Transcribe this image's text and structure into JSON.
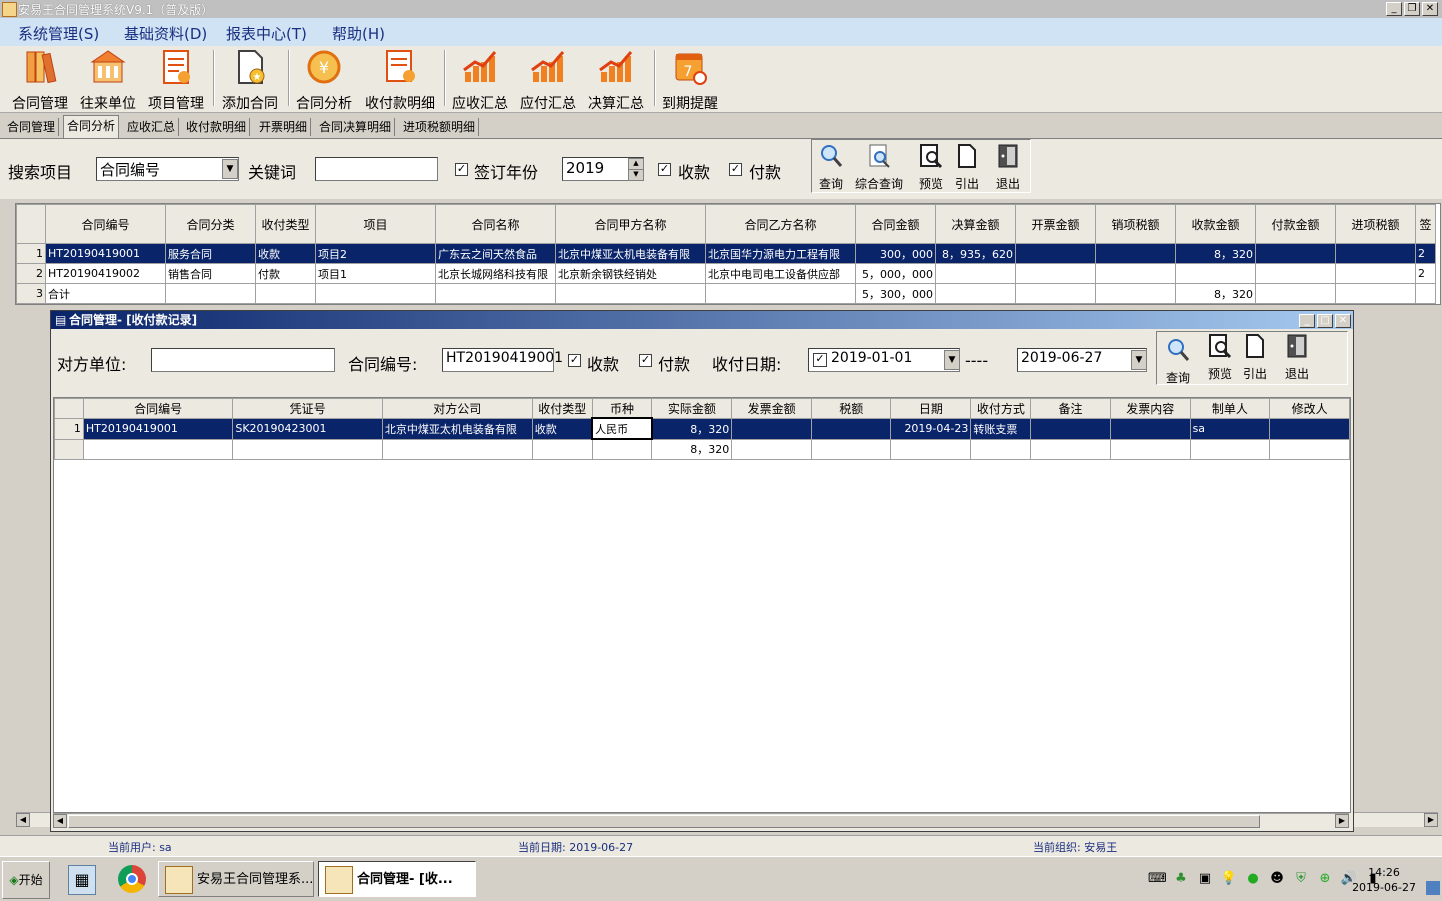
{
  "window": {
    "title": "安易王合同管理系统V9.1（普及版）"
  },
  "menu": [
    "系统管理(S)",
    "基础资料(D)",
    "报表中心(T)",
    "帮助(H)"
  ],
  "toolbar": [
    {
      "label": "合同管理",
      "icon": "contract-books-icon"
    },
    {
      "label": "往来单位",
      "icon": "building-icon"
    },
    {
      "label": "项目管理",
      "icon": "project-clipboard-icon"
    },
    {
      "label": "添加合同",
      "icon": "add-document-icon"
    },
    {
      "label": "合同分析",
      "icon": "coin-analysis-icon"
    },
    {
      "label": "收付款明细",
      "icon": "payment-detail-icon"
    },
    {
      "label": "应收汇总",
      "icon": "chart-up-icon"
    },
    {
      "label": "应付汇总",
      "icon": "chart-up-icon"
    },
    {
      "label": "决算汇总",
      "icon": "chart-up-icon"
    },
    {
      "label": "到期提醒",
      "icon": "calendar-alarm-icon"
    }
  ],
  "tabs": [
    "合同管理",
    "合同分析",
    "应收汇总",
    "收付款明细",
    "开票明细",
    "合同决算明细",
    "进项税额明细"
  ],
  "search": {
    "label_item": "搜索项目",
    "item_value": "合同编号",
    "label_keyword": "关键词",
    "keyword_value": "",
    "label_year": "签订年份",
    "year_value": "2019",
    "label_receive": "收款",
    "label_pay": "付款",
    "buttons": [
      "查询",
      "综合查询",
      "预览",
      "引出",
      "退出"
    ]
  },
  "grid1": {
    "headers": [
      "合同编号",
      "合同分类",
      "收付类型",
      "项目",
      "合同名称",
      "合同甲方名称",
      "合同乙方名称",
      "合同金额",
      "决算金额",
      "开票金额",
      "销项税额",
      "收款金额",
      "付款金额",
      "进项税额",
      "签"
    ],
    "rows": [
      [
        "1",
        "HT20190419001",
        "服务合同",
        "收款",
        "项目2",
        "广东云之间天然食品",
        "北京中煤亚太机电装备有限",
        "北京国华力源电力工程有限",
        "300，000",
        "8，935，620",
        "",
        "",
        "8，320",
        "",
        "",
        "2"
      ],
      [
        "2",
        "HT20190419002",
        "销售合同",
        "付款",
        "项目1",
        "北京长城网络科技有限",
        "北京新余钢铁经销处",
        "北京中电司电工设备供应部",
        "5，000，000",
        "",
        "",
        "",
        "",
        "",
        "",
        "2"
      ],
      [
        "3",
        "合计",
        "",
        "",
        "",
        "",
        "",
        "",
        "5，300，000",
        "",
        "",
        "",
        "8，320",
        "",
        "",
        ""
      ]
    ]
  },
  "child": {
    "title": "合同管理- [收付款记录]",
    "label_party": "对方单位:",
    "party_value": "",
    "label_contract": "合同编号:",
    "contract_value": "HT20190419001",
    "label_receive": "收款",
    "label_pay": "付款",
    "label_date": "收付日期:",
    "date_from": "2019-01-01",
    "date_sep": "----",
    "date_to": "2019-06-27",
    "buttons": [
      "查询",
      "预览",
      "引出",
      "退出"
    ],
    "headers": [
      "合同编号",
      "凭证号",
      "对方公司",
      "收付类型",
      "币种",
      "实际金额",
      "发票金额",
      "税额",
      "日期",
      "收付方式",
      "备注",
      "发票内容",
      "制单人",
      "修改人"
    ],
    "rows": [
      [
        "1",
        "HT20190419001",
        "SK20190423001",
        "北京中煤亚太机电装备有限",
        "收款",
        "人民币",
        "8，320",
        "",
        "",
        "2019-04-23",
        "转账支票",
        "",
        "",
        "sa",
        ""
      ],
      [
        "",
        "",
        "",
        "",
        "",
        "",
        "8，320",
        "",
        "",
        "",
        "",
        "",
        "",
        "",
        ""
      ]
    ]
  },
  "status": {
    "user": "当前用户: sa",
    "date": "当前日期: 2019-06-27",
    "org": "当前组织: 安易王"
  },
  "taskbar": {
    "start": "开始",
    "tasks": [
      "安易王合同管理系...",
      "合同管理- [收..."
    ],
    "time": "14:26",
    "date": "2019-06-27"
  }
}
